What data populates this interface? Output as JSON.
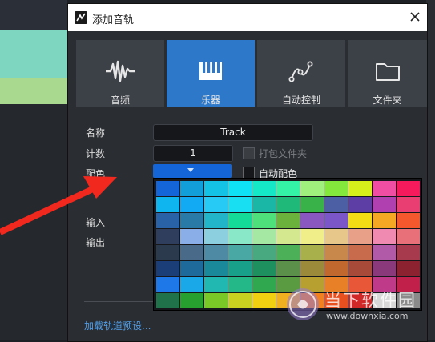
{
  "dialog": {
    "title": "添加音轨"
  },
  "tabs": [
    {
      "label": "音频",
      "icon": "waveform-icon",
      "active": false
    },
    {
      "label": "乐器",
      "icon": "keyboard-icon",
      "active": true
    },
    {
      "label": "自动控制",
      "icon": "automation-curve-icon",
      "active": false
    },
    {
      "label": "文件夹",
      "icon": "folder-icon",
      "active": false
    }
  ],
  "form": {
    "name_label": "名称",
    "name_value": "Track",
    "count_label": "计数",
    "count_value": "1",
    "pack_label": "打包文件夹",
    "color_label": "配色",
    "auto_color_label": "自动配色",
    "input_label": "输入",
    "output_label": "输出",
    "load_preset": "加载轨道预设..."
  },
  "colors": {
    "selected": "#1466d8",
    "accent": "#2d78c8"
  },
  "palette": [
    [
      "#1466d8",
      "#129fd9",
      "#14c2e6",
      "#10e2f5",
      "#14e8c6",
      "#34f2a6",
      "#a0f07e",
      "#84e83c",
      "#d6f01c",
      "#f04ea2",
      "#f51a5c"
    ],
    [
      "#0fb5ee",
      "#12aaf2",
      "#27c9f5",
      "#18e0f2",
      "#1ab6a6",
      "#1fba7a",
      "#3ab24a",
      "#4c5fa4",
      "#5c3ea4",
      "#b040b0",
      "#e83e72"
    ],
    [
      "#2a62a8",
      "#2a7aa8",
      "#22b4c8",
      "#14dc98",
      "#4ee07a",
      "#6ab23c",
      "#8a56c0",
      "#7a56c8",
      "#f4dc14",
      "#f4a824",
      "#f4582c"
    ],
    [
      "#2e3e5c",
      "#8aaee8",
      "#8cd0e0",
      "#88e8c8",
      "#a4e8a4",
      "#d4e890",
      "#f0ee88",
      "#e8c88a",
      "#e8a088",
      "#f08ab0",
      "#e87078"
    ],
    [
      "#2c3a4e",
      "#4a6a8a",
      "#4e8aa4",
      "#4aa8a4",
      "#48a880",
      "#4cb058",
      "#a8b04c",
      "#c8884c",
      "#c86a4c",
      "#b05aa8",
      "#a83a4e"
    ],
    [
      "#1c3e78",
      "#1e6a9a",
      "#1a8a9a",
      "#18a08a",
      "#1e9060",
      "#5a904a",
      "#9a8a3a",
      "#c0682e",
      "#a84a3a",
      "#8a3a7a",
      "#8c2230"
    ],
    [
      "#1e78e8",
      "#1aa8e8",
      "#20b8b0",
      "#24b888",
      "#30a850",
      "#5a9a40",
      "#b8a030",
      "#e88028",
      "#e85838",
      "#c03a8a",
      "#c0204a"
    ],
    [
      "#20724a",
      "#28a030",
      "#7ac828",
      "#c8d020",
      "#f0d010",
      "#f0b020",
      "#f08020",
      "#e85020",
      "#d02828",
      "#d8d8d8",
      "#8a8a8a"
    ]
  ],
  "watermark": {
    "text": "当下软件园",
    "url": "www.downxia.com"
  }
}
